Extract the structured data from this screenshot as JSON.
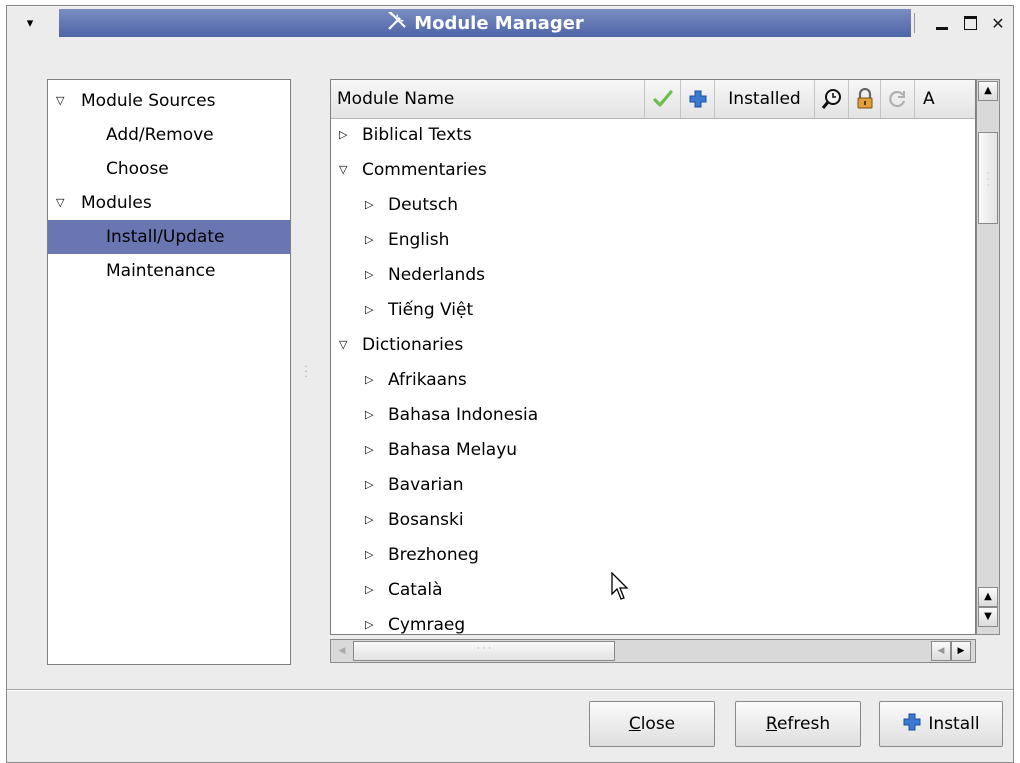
{
  "window": {
    "title": "Module Manager",
    "app_icon": "tools-icon",
    "menu_glyph": "▾",
    "close_glyph": "✕"
  },
  "nav": {
    "items": [
      {
        "label": "Module Sources",
        "expander": "▽",
        "level": 0
      },
      {
        "label": "Add/Remove",
        "level": 1
      },
      {
        "label": "Choose",
        "level": 1
      },
      {
        "label": "Modules",
        "expander": "▽",
        "level": 0
      },
      {
        "label": "Install/Update",
        "level": 1,
        "selected": true
      },
      {
        "label": "Maintenance",
        "level": 1
      }
    ]
  },
  "table": {
    "columns": {
      "name": "Module Name",
      "installed": "Installed",
      "cut_off": "A"
    },
    "column_icons": [
      "checkmark-icon",
      "plus-icon",
      "installed",
      "search-icon",
      "lock-icon",
      "refresh-icon"
    ],
    "rows": [
      {
        "label": "Biblical Texts",
        "expander": "▷",
        "level": 0
      },
      {
        "label": "Commentaries",
        "expander": "▽",
        "level": 0
      },
      {
        "label": "Deutsch",
        "expander": "▷",
        "level": 1
      },
      {
        "label": "English",
        "expander": "▷",
        "level": 1
      },
      {
        "label": "Nederlands",
        "expander": "▷",
        "level": 1
      },
      {
        "label": "Tiếng Việt",
        "expander": "▷",
        "level": 1
      },
      {
        "label": "Dictionaries",
        "expander": "▽",
        "level": 0
      },
      {
        "label": "Afrikaans",
        "expander": "▷",
        "level": 1
      },
      {
        "label": "Bahasa Indonesia",
        "expander": "▷",
        "level": 1
      },
      {
        "label": "Bahasa Melayu",
        "expander": "▷",
        "level": 1
      },
      {
        "label": "Bavarian",
        "expander": "▷",
        "level": 1
      },
      {
        "label": "Bosanski",
        "expander": "▷",
        "level": 1
      },
      {
        "label": "Brezhoneg",
        "expander": "▷",
        "level": 1
      },
      {
        "label": "Català",
        "expander": "▷",
        "level": 1
      },
      {
        "label": "Cymraeg",
        "expander": "▷",
        "level": 1
      }
    ]
  },
  "buttons": {
    "close": {
      "mnemonic": "C",
      "rest": "lose"
    },
    "refresh": {
      "mnemonic": "R",
      "rest": "efresh"
    },
    "install": {
      "label": "Install"
    }
  },
  "colors": {
    "title_bar": "#5a6fb0",
    "selection": "#6a76b2",
    "check_green": "#6ac04a",
    "plus_blue": "#3a7ad0"
  }
}
